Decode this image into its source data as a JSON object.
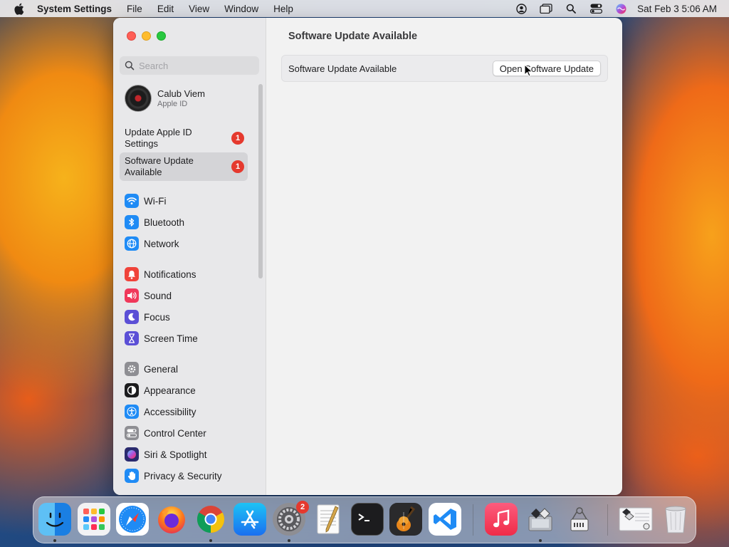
{
  "menubar": {
    "app_name": "System Settings",
    "menus": [
      "File",
      "Edit",
      "View",
      "Window",
      "Help"
    ],
    "clock": "Sat Feb 3  5:06 AM"
  },
  "sidebar": {
    "search_placeholder": "Search",
    "profile": {
      "name": "Calub Viem",
      "subtitle": "Apple ID"
    },
    "alerts": [
      {
        "label": "Update Apple ID Settings",
        "badge": "1"
      },
      {
        "label": "Software Update Available",
        "badge": "1"
      }
    ],
    "groups": [
      [
        {
          "label": "Wi-Fi",
          "icon": "wifi-icon",
          "color": "#1f8bf5"
        },
        {
          "label": "Bluetooth",
          "icon": "bluetooth-icon",
          "color": "#1f8bf5"
        },
        {
          "label": "Network",
          "icon": "globe-icon",
          "color": "#1f8bf5"
        }
      ],
      [
        {
          "label": "Notifications",
          "icon": "bell-icon",
          "color": "#f0433a"
        },
        {
          "label": "Sound",
          "icon": "speaker-icon",
          "color": "#f0385a"
        },
        {
          "label": "Focus",
          "icon": "moon-icon",
          "color": "#5b4fd6"
        },
        {
          "label": "Screen Time",
          "icon": "hourglass-icon",
          "color": "#5b4fd6"
        }
      ],
      [
        {
          "label": "General",
          "icon": "gear-icon",
          "color": "#8e8e93"
        },
        {
          "label": "Appearance",
          "icon": "appearance-icon",
          "color": "#1c1c1e"
        },
        {
          "label": "Accessibility",
          "icon": "accessibility-icon",
          "color": "#1f8bf5"
        },
        {
          "label": "Control Center",
          "icon": "toggles-icon",
          "color": "#8e8e93"
        },
        {
          "label": "Siri & Spotlight",
          "icon": "siri-icon",
          "color": "#2a2a6e"
        },
        {
          "label": "Privacy & Security",
          "icon": "hand-icon",
          "color": "#1f8bf5"
        }
      ]
    ]
  },
  "content": {
    "title": "Software Update Available",
    "row_label": "Software Update Available",
    "button_label": "Open Software Update"
  },
  "dock": {
    "system_settings_badge": "2",
    "apps": [
      "finder",
      "launchpad",
      "safari",
      "firefox",
      "chrome",
      "app-store",
      "system-settings",
      "textedit",
      "terminal",
      "garageband",
      "vscode",
      "music",
      "migration-assistant",
      "system-information",
      "preview",
      "trash"
    ]
  }
}
